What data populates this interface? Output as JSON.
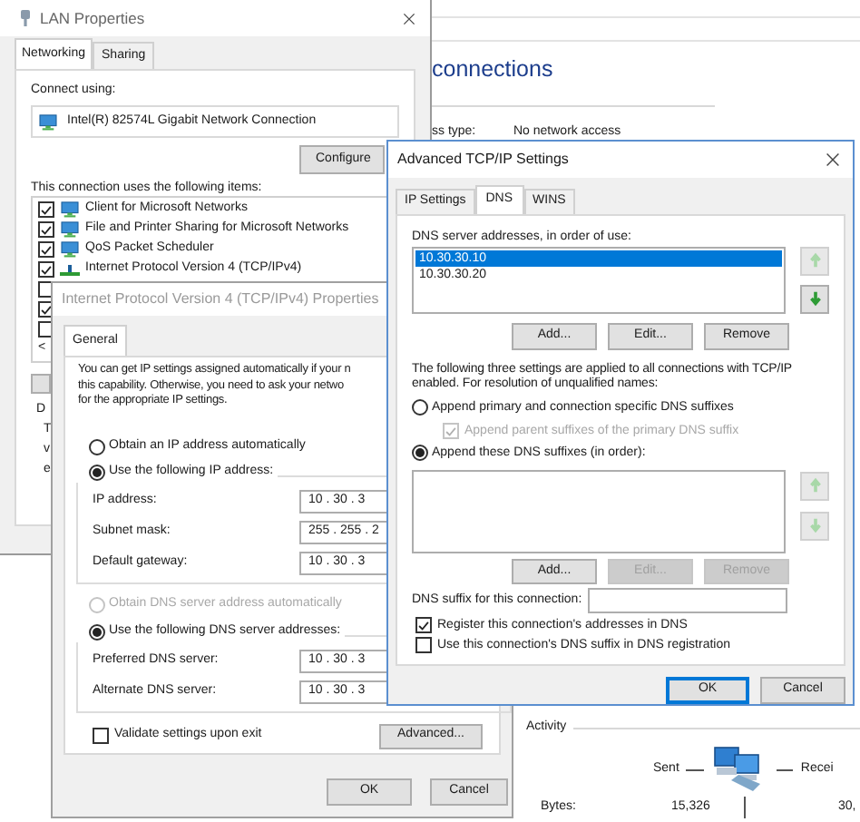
{
  "status_window": {
    "heading": "connections",
    "access_type_label": "ss type:",
    "access_type_value": "No network access",
    "activity_label": "Activity",
    "sent_label": "Sent",
    "received_label": "Recei",
    "bytes_label": "Bytes:",
    "bytes_sent": "15,326",
    "bytes_received": "30,"
  },
  "lan_properties": {
    "title": "LAN Properties",
    "tabs": [
      {
        "label": "Networking",
        "selected": true
      },
      {
        "label": "Sharing",
        "selected": false
      }
    ],
    "connect_using_label": "Connect using:",
    "adapter": "Intel(R) 82574L Gigabit Network Connection",
    "configure_button": "Configure",
    "items_label": "This connection uses the following items:",
    "items": [
      {
        "kind": "client",
        "label": "Client for Microsoft Networks",
        "checked": true
      },
      {
        "kind": "service",
        "label": "File and Printer Sharing for Microsoft Networks",
        "checked": true
      },
      {
        "kind": "service",
        "label": "QoS Packet Scheduler",
        "checked": true
      },
      {
        "kind": "protocol",
        "label": "Internet Protocol Version 4 (TCP/IPv4)",
        "checked": true
      },
      {
        "checked": false
      },
      {
        "checked": true
      },
      {
        "checked": false
      }
    ],
    "scroll_arrow": "<",
    "description_label": "D",
    "description_fragments": [
      "T",
      "v",
      "e"
    ]
  },
  "ipv4_properties": {
    "title": "Internet Protocol Version 4 (TCP/IPv4) Properties",
    "tabs": [
      {
        "label": "General",
        "selected": true
      }
    ],
    "intro_lines": [
      "You can get IP settings assigned automatically if your n",
      "this capability. Otherwise, you need to ask your netwo",
      "for the appropriate IP settings."
    ],
    "ip_mode": [
      {
        "label": "Obtain an IP address automatically",
        "selected": false
      },
      {
        "label": "Use the following IP address:",
        "selected": true
      }
    ],
    "ip_fields": [
      {
        "label": "IP address:",
        "value": "10 . 30 . 3"
      },
      {
        "label": "Subnet mask:",
        "value": "255 . 255 . 2"
      },
      {
        "label": "Default gateway:",
        "value": "10 . 30 . 3"
      }
    ],
    "dns_mode": [
      {
        "label": "Obtain DNS server address automatically",
        "selected": false,
        "disabled": true
      },
      {
        "label": "Use the following DNS server addresses:",
        "selected": true,
        "disabled": false
      }
    ],
    "dns_fields": [
      {
        "label": "Preferred DNS server:",
        "value": "10 . 30 . 3"
      },
      {
        "label": "Alternate DNS server:",
        "value": "10 . 30 . 3"
      }
    ],
    "validate": {
      "label": "Validate settings upon exit",
      "checked": false
    },
    "advanced_button": "Advanced...",
    "ok_button": "OK",
    "cancel_button": "Cancel"
  },
  "advanced_tcpip_settings": {
    "title": "Advanced TCP/IP Settings",
    "tabs": [
      {
        "label": "IP Settings",
        "selected": false
      },
      {
        "label": "DNS",
        "selected": true
      },
      {
        "label": "WINS",
        "selected": false
      }
    ],
    "servers_label": "DNS server addresses, in order of use:",
    "servers": [
      {
        "address": "10.30.30.10",
        "selected": true
      },
      {
        "address": "10.30.30.20",
        "selected": false
      }
    ],
    "server_arrows": [
      {
        "kind": "up",
        "disabled": true
      },
      {
        "kind": "down",
        "disabled": false
      }
    ],
    "server_buttons": [
      {
        "label": "Add...",
        "disabled": false
      },
      {
        "label": "Edit...",
        "disabled": false
      },
      {
        "label": "Remove",
        "disabled": false
      }
    ],
    "note_lines": [
      "The following three settings are applied to all connections with TCP/IP",
      "enabled. For resolution of unqualified names:"
    ],
    "append_primary": {
      "label": "Append primary and connection specific DNS suffixes",
      "selected": false
    },
    "append_parent": {
      "label": "Append parent suffixes of the primary DNS suffix",
      "checked": true,
      "disabled": true
    },
    "append_these": {
      "label": "Append these DNS suffixes (in order):",
      "selected": true
    },
    "suffix_arrows": [
      {
        "kind": "up",
        "disabled": true
      },
      {
        "kind": "down",
        "disabled": true
      }
    ],
    "suffix_buttons": [
      {
        "label": "Add...",
        "disabled": false
      },
      {
        "label": "Edit...",
        "disabled": true
      },
      {
        "label": "Remove",
        "disabled": true
      }
    ],
    "suffix_field_label": "DNS suffix for this connection:",
    "register": {
      "label": "Register this connection's addresses in DNS",
      "checked": true
    },
    "use_suffix": {
      "label": "Use this connection's DNS suffix in DNS registration",
      "checked": false
    },
    "ok_button": "OK",
    "cancel_button": "Cancel"
  }
}
